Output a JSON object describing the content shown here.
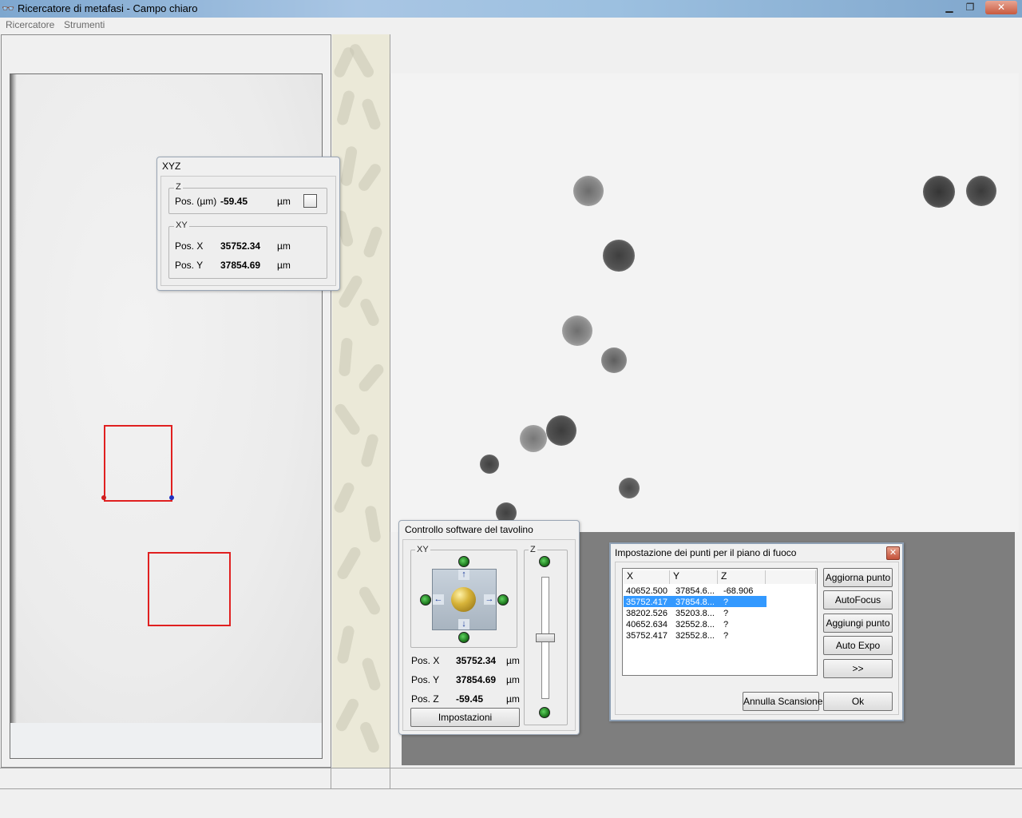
{
  "window": {
    "title": "Ricercatore di metafasi - Campo chiaro",
    "app_icon": "binoculars-icon"
  },
  "menu": {
    "items": [
      "Ricercatore",
      "Strumenti"
    ]
  },
  "xyz_dialog": {
    "title": "XYZ",
    "z_group": "Z",
    "z_label": "Pos. (µm)",
    "z_value": "-59.45",
    "z_unit": "µm",
    "xy_group": "XY",
    "x_label": "Pos. X",
    "x_value": "35752.34",
    "x_unit": "µm",
    "y_label": "Pos. Y",
    "y_value": "37854.69",
    "y_unit": "µm"
  },
  "stage_dialog": {
    "title": "Controllo software del tavolino",
    "xy_group": "XY",
    "z_group": "Z",
    "x_label": "Pos. X",
    "x_value": "35752.34",
    "x_unit": "µm",
    "y_label": "Pos. Y",
    "y_value": "37854.69",
    "y_unit": "µm",
    "z_label": "Pos. Z",
    "z_value": "-59.45",
    "z_unit": "µm",
    "settings_button": "Impostazioni"
  },
  "focus_dialog": {
    "title": "Impostazione dei punti per il piano di fuoco",
    "columns": [
      "X",
      "Y",
      "Z"
    ],
    "rows": [
      [
        "40652.500",
        "37854.6...",
        "-68.906"
      ],
      [
        "35752.417",
        "37854.8...",
        "?"
      ],
      [
        "38202.526",
        "35203.8...",
        "?"
      ],
      [
        "40652.634",
        "32552.8...",
        "?"
      ],
      [
        "35752.417",
        "32552.8...",
        "?"
      ]
    ],
    "selected_row": 1,
    "buttons": {
      "update": "Aggiorna punto",
      "autofocus": "AutoFocus",
      "add": "Aggiungi punto",
      "autoexpo": "Auto Expo",
      "more": ">>",
      "cancel_scan": "Annulla Scansione",
      "ok": "Ok"
    }
  },
  "colors": {
    "selection": "#3399ff",
    "marker": "#e02020",
    "led": "#2fa82f"
  }
}
